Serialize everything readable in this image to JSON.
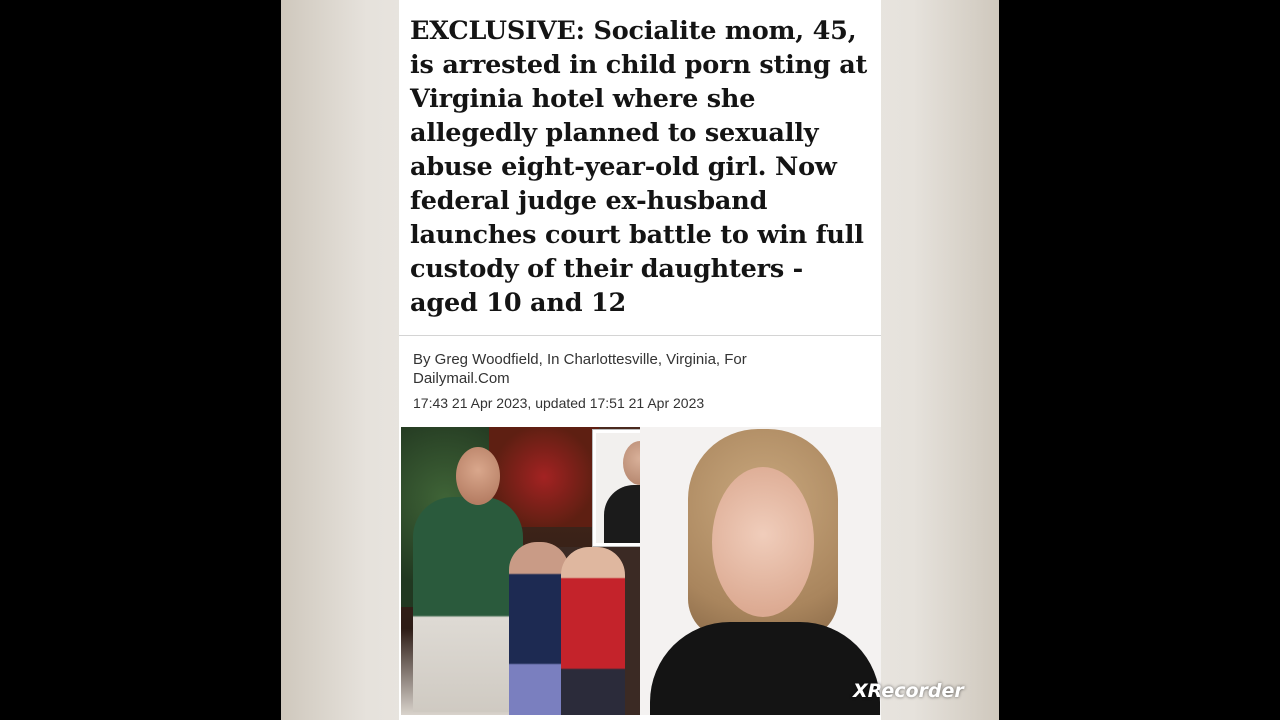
{
  "article": {
    "headline": "EXCLUSIVE: Socialite mom, 45, is arrested in child porn sting at Virginia hotel where she allegedly planned to sexually abuse eight-year-old girl. Now federal judge ex-husband launches court battle to win full custody of their daughters - aged 10 and 12",
    "byline": "By Greg Woodfield, In Charlottesville, Virginia, For Dailymail.Com",
    "timestamp": "17:43 21 Apr 2023, updated 17:51 21 Apr 2023"
  },
  "overlay": {
    "watermark": "XRecorder"
  },
  "colors": {
    "background": "#000000",
    "page": "#ffffff",
    "text": "#141414"
  }
}
